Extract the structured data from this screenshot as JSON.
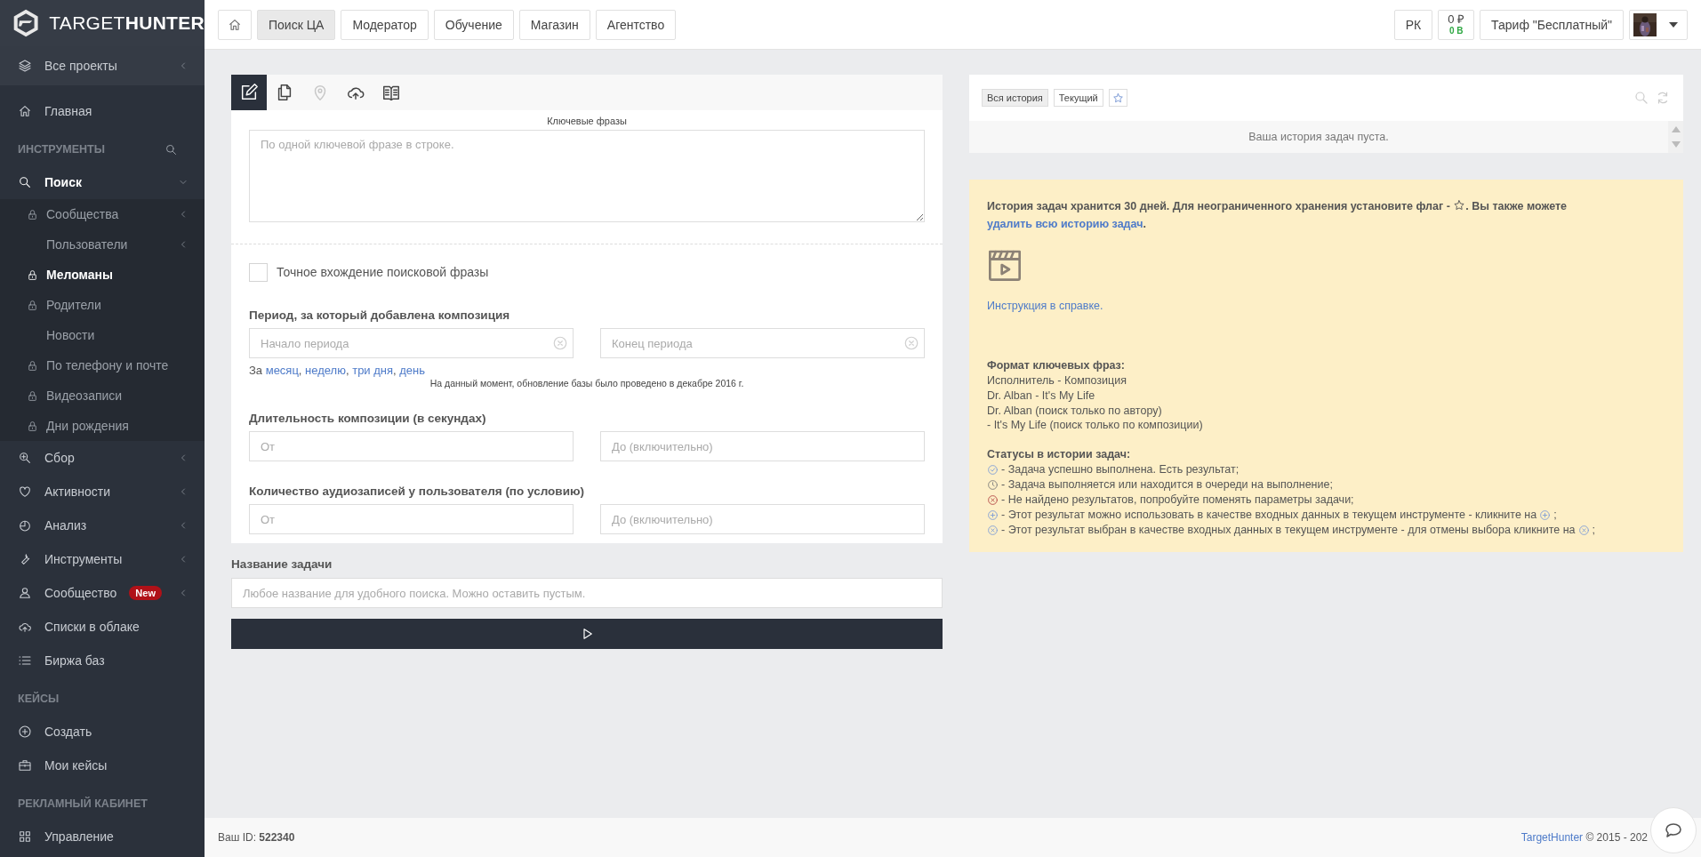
{
  "sidebar": {
    "logo": "TARGET**HUNTER**",
    "items": [
      {
        "kind": "project",
        "label": "Все проекты",
        "selected": false,
        "submenu": true
      },
      {
        "kind": "item",
        "label": "Главная",
        "selected": false,
        "submenu": false
      },
      {
        "kind": "section",
        "label": "ИНСТРУМЕНТЫ",
        "search": true
      },
      {
        "kind": "item",
        "label": "Поиск",
        "selected": true,
        "submenu": true,
        "expanded": true,
        "children": [
          {
            "label": "Сообщества",
            "locked": true,
            "selected": false,
            "submenu": true
          },
          {
            "label": "Пользователи",
            "locked": false,
            "selected": false,
            "submenu": true
          },
          {
            "label": "Меломаны",
            "locked": true,
            "selected": true,
            "submenu": false
          },
          {
            "label": "Родители",
            "locked": true,
            "selected": false,
            "submenu": false
          },
          {
            "label": "Новости",
            "locked": false,
            "selected": false,
            "submenu": false
          },
          {
            "label": "По телефону и почте",
            "locked": true,
            "selected": false,
            "submenu": false
          },
          {
            "label": "Видеозаписи",
            "locked": true,
            "selected": false,
            "submenu": false
          },
          {
            "label": "Дни рождения",
            "locked": true,
            "selected": false,
            "submenu": false
          }
        ]
      },
      {
        "kind": "item",
        "label": "Сбор",
        "selected": false,
        "submenu": true
      },
      {
        "kind": "item",
        "label": "Активности",
        "selected": false,
        "submenu": true
      },
      {
        "kind": "item",
        "label": "Анализ",
        "selected": false,
        "submenu": true
      },
      {
        "kind": "item",
        "label": "Инструменты",
        "selected": false,
        "submenu": true
      },
      {
        "kind": "item",
        "label": "Сообщество",
        "badge": "New",
        "selected": false,
        "submenu": true
      },
      {
        "kind": "item",
        "label": "Списки в облаке",
        "selected": false,
        "submenu": false
      },
      {
        "kind": "item",
        "label": "Биржа баз",
        "selected": false,
        "submenu": false
      },
      {
        "kind": "section",
        "label": "КЕЙСЫ",
        "search": false
      },
      {
        "kind": "item",
        "label": "Создать",
        "selected": false,
        "submenu": false
      },
      {
        "kind": "item",
        "label": "Мои кейсы",
        "selected": false,
        "submenu": false
      },
      {
        "kind": "section",
        "label": "РЕКЛАМНЫЙ КАБИНЕТ",
        "search": false
      },
      {
        "kind": "item",
        "label": "Управление",
        "selected": false,
        "submenu": false
      }
    ]
  },
  "topbar": {
    "tabs": [
      {
        "label": "Поиск ЦА",
        "selected": true
      },
      {
        "label": "Модератор",
        "selected": false
      },
      {
        "label": "Обучение",
        "selected": false
      },
      {
        "label": "Магазин",
        "selected": false
      },
      {
        "label": "Агентство",
        "selected": false
      }
    ],
    "ads_button": "РК",
    "balance": {
      "money": "0 ₽",
      "points": "0 В"
    },
    "tariff": "Тариф \"Бесплатный\""
  },
  "form": {
    "tool_tabs": [
      {
        "selected": true,
        "disabled": false
      },
      {
        "selected": false,
        "disabled": false
      },
      {
        "selected": false,
        "disabled": true
      },
      {
        "selected": false,
        "disabled": false
      },
      {
        "selected": false,
        "disabled": false
      }
    ],
    "keywords": {
      "label": "Ключевые фразы",
      "placeholder": "По одной ключевой фразе в строке."
    },
    "exact": {
      "label": "Точное вхождение поисковой фразы",
      "checked": false
    },
    "period": {
      "label": "Период, за который добавлена композиция",
      "fields": [
        {
          "placeholder": "Начало периода"
        },
        {
          "placeholder": "Конец периода"
        }
      ],
      "quick": {
        "prefix": "За",
        "links": [
          "месяц",
          "неделю",
          "три дня",
          "день"
        ],
        "separator": ", "
      },
      "note": "На данный момент, обновление базы было проведено в декабре 2016 г."
    },
    "ranges": [
      {
        "label": "Длительность композиции (в секундах)",
        "fields": [
          {
            "placeholder": "От"
          },
          {
            "placeholder": "До (включительно)"
          }
        ]
      },
      {
        "label": "Количество аудиозаписей у пользователя (по условию)",
        "fields": [
          {
            "placeholder": "От"
          },
          {
            "placeholder": "До (включительно)"
          }
        ]
      }
    ],
    "task_name": {
      "label": "Название задачи",
      "placeholder": "Любое название для удобного поиска. Можно оставить пустым."
    }
  },
  "history": {
    "tabs": [
      {
        "label": "Вся история",
        "selected": true
      },
      {
        "label": "Текущий",
        "selected": false
      }
    ],
    "empty": "Ваша история задач пуста."
  },
  "info": {
    "intro": {
      "before": "История задач хранится 30 дней. Для неограниченного хранения установите флаг - ",
      "after": ". Вы также можете ",
      "link": "удалить всю историю задач",
      "end": "."
    },
    "help_link": "Инструкция в справке.",
    "format": {
      "title": "Формат ключевых фраз:",
      "lines": [
        "Исполнитель - Композиция",
        "Dr. Alban - It's My Life",
        "Dr. Alban (поиск только по автору)",
        "- It's My Life (поиск только по композиции)"
      ]
    },
    "statuses": {
      "title": "Статусы в истории задач:",
      "items": [
        {
          "kind": "success",
          "text": "- Задача успешно выполнена. Есть результат;"
        },
        {
          "kind": "pending",
          "text": "- Задача выполняется или находится в очереди на выполнение;"
        },
        {
          "kind": "failed",
          "text": "- Не найдено результатов, попробуйте поменять параметры задачи;"
        },
        {
          "kind": "available",
          "text": "- Этот результат можно использовать в качестве входных данных в текущем инструменте - кликните на",
          "end": ";"
        },
        {
          "kind": "chosen",
          "text": "- Этот результат выбран в качестве входных данных в текущем инструменте - для отмены выбора кликните на",
          "end": ";"
        }
      ]
    }
  },
  "footer": {
    "user_id": "Ваш ID: **522340**",
    "brand": "TargetHunter",
    "copyright": "© 2015 - 202"
  }
}
